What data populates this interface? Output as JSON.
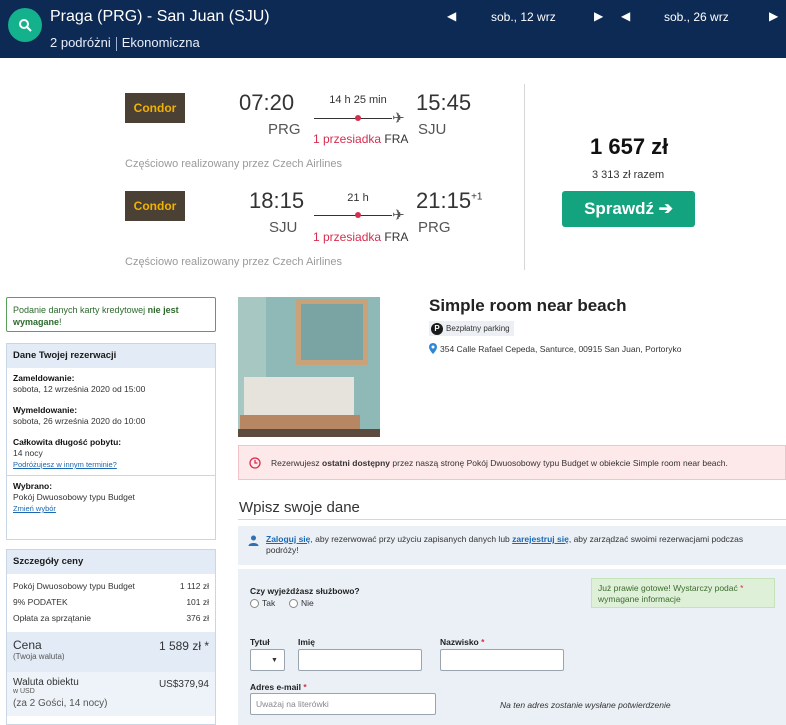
{
  "topbar": {
    "route": "Praga (PRG) - San Juan (SJU)",
    "travellers": "2 podróżni",
    "cabin": "Ekonomiczna",
    "depart_date": "sob., 12 wrz",
    "return_date": "sob., 26 wrz"
  },
  "flights": {
    "outbound": {
      "airline": "Condor",
      "dep_time": "07:20",
      "dep_code": "PRG",
      "duration": "14 h 25 min",
      "stops": "1 przesiadka",
      "via": "FRA",
      "arr_time": "15:45",
      "arr_code": "SJU",
      "operated": "Częściowo realizowany przez Czech Airlines"
    },
    "inbound": {
      "airline": "Condor",
      "dep_time": "18:15",
      "dep_code": "SJU",
      "duration": "21 h",
      "stops": "1 przesiadka",
      "via": "FRA",
      "arr_time": "21:15",
      "arr_plus": "+1",
      "arr_code": "PRG",
      "operated": "Częściowo realizowany przez Czech Airlines"
    },
    "price": "1 657 zł",
    "total": "3 313 zł razem",
    "cta": "Sprawdź ➔"
  },
  "sidebar": {
    "cc_note_pre": "Podanie danych karty kredytowej ",
    "cc_note_bold": "nie jest wymagane",
    "cc_note_post": "!",
    "booking_title": "Dane Twojej rezerwacji",
    "checkin_label": "Zameldowanie:",
    "checkin_value": "sobota, 12 września 2020 od 15:00",
    "checkout_label": "Wymeldowanie:",
    "checkout_value": "sobota, 26 września 2020 do 10:00",
    "stay_label": "Całkowita długość pobytu:",
    "stay_value": "14 nocy",
    "other_dates_link": "Podróżujesz w innym terminie?",
    "selected_label": "Wybrano:",
    "selected_value": "Pokój Dwuosobowy typu Budget",
    "change_link": "Zmień wybór",
    "price_title": "Szczegóły ceny",
    "price_rows": [
      {
        "label": "Pokój Dwuosobowy typu Budget",
        "value": "1 112 zł"
      },
      {
        "label": "9% PODATEK",
        "value": "101 zł"
      },
      {
        "label": "Opłata za sprzątanie",
        "value": "376 zł"
      }
    ],
    "cena_label": "Cena",
    "cena_sub": "(Twoja waluta)",
    "cena_value": "1 589 zł *",
    "walut_label": "Waluta obiektu",
    "walut_sub": "w USD",
    "walut_value": "US$379,94",
    "guests": "(za 2 Gości, 14 nocy)"
  },
  "hotel": {
    "title": "Simple room near beach",
    "parking": "Bezpłatny parking",
    "address": "354 Calle Rafael Cepeda, Santurce, 00915 San Juan, Portoryko",
    "alert_pre": "Rezerwujesz ",
    "alert_bold": "ostatni dostępny",
    "alert_post": " przez naszą stronę Pokój Dwuosobowy typu Budget w obiekcie Simple room near beach."
  },
  "form": {
    "title": "Wpisz swoje dane",
    "login_link": "Zaloguj się",
    "login_mid": ", aby rezerwować przy użyciu zapisanych danych lub ",
    "register_link": "zarejestruj się",
    "login_post": ", aby zarządzać swoimi rezerwacjami podczas podróży!",
    "business_q": "Czy wyjeżdżasz służbowo?",
    "yes": "Tak",
    "no": "Nie",
    "almost_text": "Już prawie gotowe! Wystarczy podać",
    "almost_text2": "wymagane informacje",
    "title_label": "Tytuł",
    "first_name_label": "Imię",
    "last_name_label": "Nazwisko",
    "email_label": "Adres e-mail",
    "email_placeholder": "Uważaj na literówki",
    "email_note": "Na ten adres zostanie wysłane potwierdzenie",
    "req": "*"
  },
  "colors": {
    "topbar": "#0d2a55",
    "accent": "#14a37f",
    "alert_red": "#d62e4f"
  }
}
